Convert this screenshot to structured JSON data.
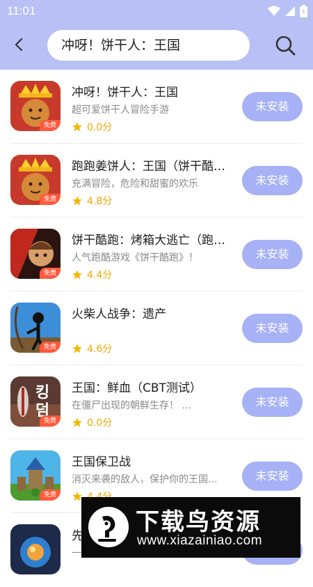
{
  "status_bar": {
    "time": "11:01"
  },
  "search": {
    "query": "冲呀！饼干人：王国"
  },
  "apps": [
    {
      "name": "冲呀！饼干人：王国",
      "desc": "超可爱饼干人冒险手游",
      "rating": "0.0分",
      "badge": "免费",
      "install": "未安装",
      "icon": "cookie-kingdom-icon"
    },
    {
      "name": "跑跑姜饼人：王国（饼干酷跑）",
      "desc": "充满冒险，危险和甜蜜的欢乐",
      "rating": "4.8分",
      "badge": "免费",
      "install": "未安装",
      "icon": "cookie-kingdom-icon"
    },
    {
      "name": "饼干酷跑：烤箱大逃亡（跑跑姜饼人）",
      "desc": "人气跑酷游戏《饼干酷跑》！",
      "rating": "4.4分",
      "badge": "免费",
      "install": "未安装",
      "icon": "cookie-run-icon"
    },
    {
      "name": "火柴人战争：遗产",
      "desc": "",
      "rating": "4.6分",
      "badge": "免费",
      "install": "未安装",
      "icon": "stickman-icon"
    },
    {
      "name": "王国：鲜血（CBT测试）",
      "desc": "在僵尸出现的朝鲜生存！ ...",
      "rating": "0.0分",
      "badge": "免费",
      "install": "未安装",
      "icon": "kingdom-blood-icon"
    },
    {
      "name": "王国保卫战",
      "desc": "消灭来袭的敌人，保护你的王国...",
      "rating": "4.4分",
      "badge": "免费",
      "install": "未安装",
      "icon": "kingdom-rush-icon"
    },
    {
      "name": "先",
      "desc": "一款发人深省的快节奏战略游戏",
      "rating": "",
      "badge": "",
      "install": "未安装",
      "icon": "orb-icon"
    }
  ],
  "watermark": {
    "title": "下载鸟资源",
    "url": "www.xiazainiao.com"
  },
  "colors": {
    "header_bg": "#b8c0f6",
    "install_bg": "#a6b1f6",
    "star": "#f7b500",
    "free_badge": "#ff5a3c"
  }
}
